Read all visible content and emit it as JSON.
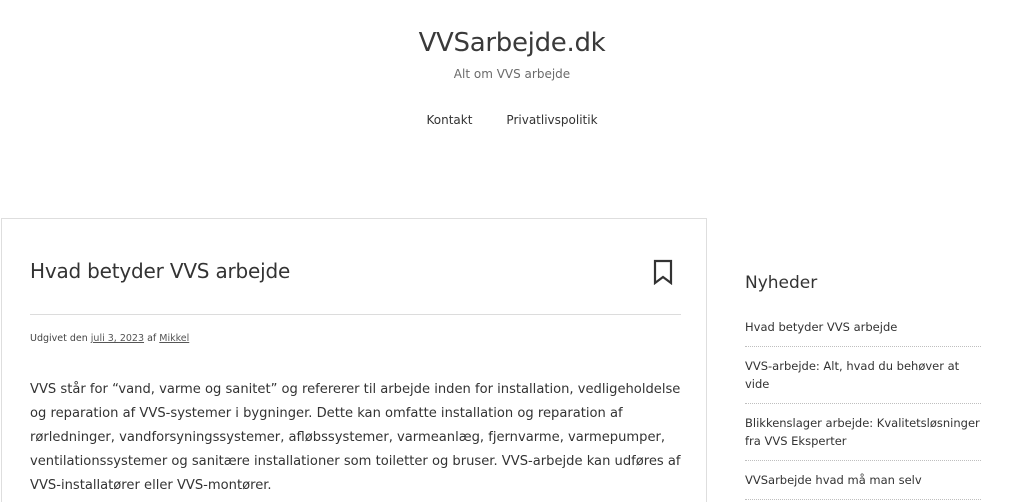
{
  "header": {
    "site_title": "VVSarbejde.dk",
    "tagline": "Alt om VVS arbejde"
  },
  "nav": {
    "items": [
      {
        "label": "Kontakt"
      },
      {
        "label": "Privatlivspolitik"
      }
    ]
  },
  "article": {
    "title": "Hvad betyder VVS arbejde",
    "bookmark_icon": "bookmark-icon",
    "meta": {
      "published_prefix": "Udgivet den",
      "date": "juli 3, 2023",
      "by": "af",
      "author": "Mikkel"
    },
    "body": "VVS står for “vand, varme og sanitet” og refererer til arbejde inden for installation, vedligeholdelse og reparation af VVS-systemer i bygninger. Dette kan omfatte installation og reparation af rørledninger, vandforsyningssystemer, afløbssystemer, varmeanlæg, fjernvarme, varmepumper, ventilationssystemer og sanitære installationer som toiletter og bruser. VVS-arbejde kan udføres af VVS-installatører eller VVS-montører."
  },
  "sidebar": {
    "widget_title": "Nyheder",
    "items": [
      {
        "label": "Hvad betyder VVS arbejde"
      },
      {
        "label": "VVS-arbejde: Alt, hvad du behøver at vide"
      },
      {
        "label": "Blikkenslager arbejde: Kvalitetsløsninger fra VVS Eksperter"
      },
      {
        "label": "VVSarbejde hvad må man selv"
      }
    ]
  }
}
